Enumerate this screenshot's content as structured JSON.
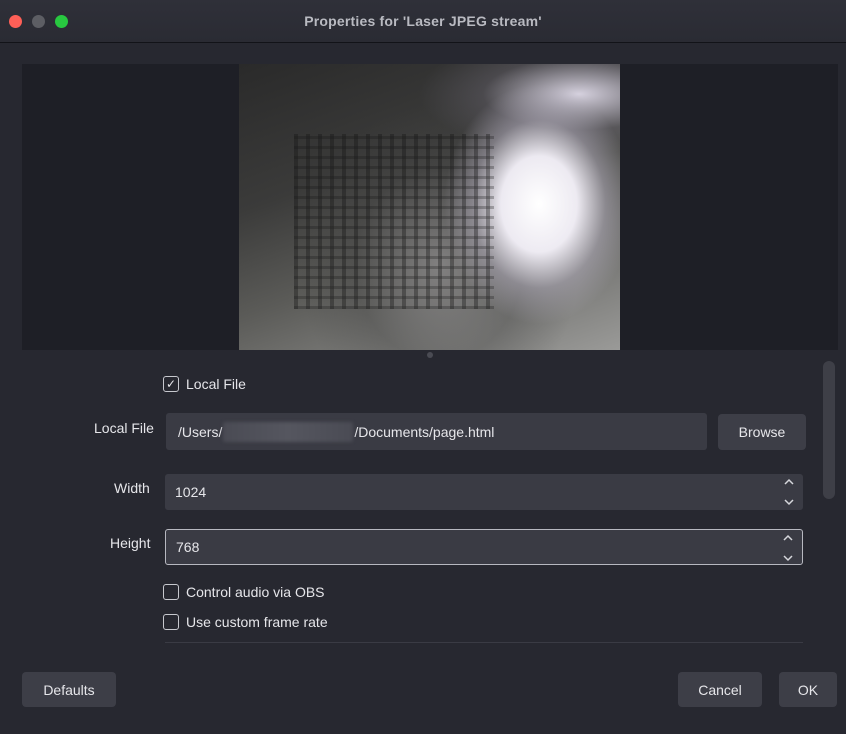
{
  "window": {
    "title": "Properties for 'Laser JPEG stream'"
  },
  "preview": {
    "has_image": true
  },
  "form": {
    "local_file_checkbox": {
      "label": "Local File",
      "checked": true,
      "check_glyph": "✓"
    },
    "local_file": {
      "label": "Local File",
      "path_prefix": "/Users/",
      "path_suffix": "/Documents/page.html"
    },
    "browse_label": "Browse",
    "width": {
      "label": "Width",
      "value": "1024"
    },
    "height": {
      "label": "Height",
      "value": "768"
    },
    "control_audio": {
      "label": "Control audio via OBS",
      "checked": false
    },
    "custom_frame_rate": {
      "label": "Use custom frame rate",
      "checked": false
    }
  },
  "footer": {
    "defaults_label": "Defaults",
    "cancel_label": "Cancel",
    "ok_label": "OK"
  },
  "colors": {
    "background": "#272830",
    "preview_bg": "#1e1f26",
    "field_bg": "#3a3b44",
    "button_bg": "#3d3e47",
    "close": "#fe5f57",
    "maximize": "#28c840"
  },
  "icons": {
    "close": "close-icon",
    "minimize": "minimize-icon",
    "maximize": "maximize-icon",
    "spin_up": "chevron-up-icon",
    "spin_down": "chevron-down-icon",
    "checkmark": "checkmark-icon"
  }
}
